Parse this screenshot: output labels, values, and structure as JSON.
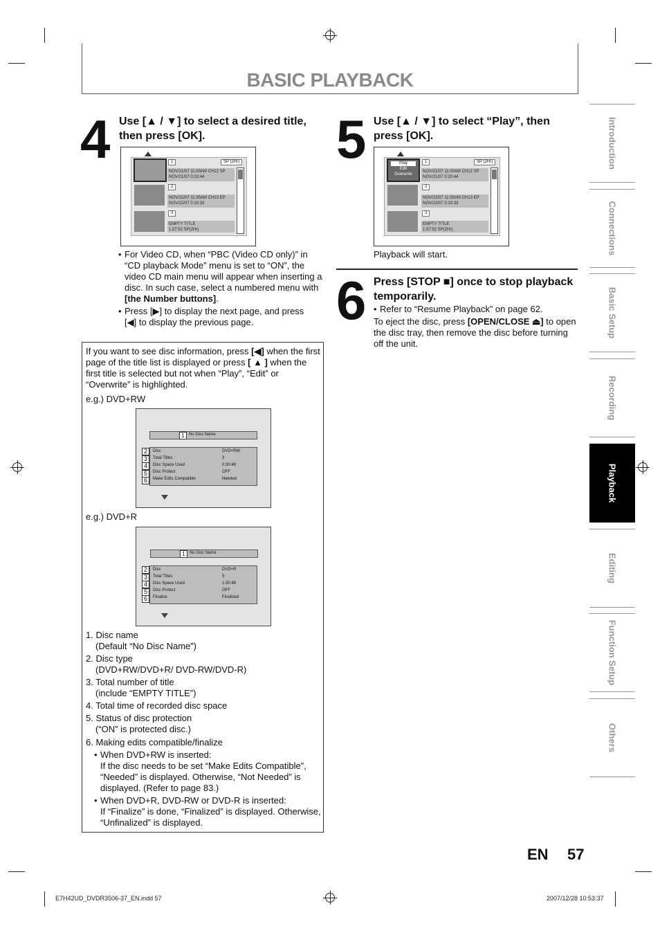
{
  "page_title": "BASIC PLAYBACK",
  "step4": {
    "number": "4",
    "title": "Use [▲ / ▼] to select a desired title, then press [OK].",
    "bullet1_pre": "For Video CD, when “PBC (Video CD only)” in “CD playback Mode” menu is set to “ON”, the video CD main menu will appear when inserting a disc. In such case, select a numbered menu with ",
    "bullet1_bold": "[the Number buttons]",
    "bullet1_post": ".",
    "bullet2_line1": "Press [▶] to display the next page, and press",
    "bullet2_line2": "[◀] to display the previous page."
  },
  "title_list": {
    "sp_tag": "SP (2Hr)",
    "items": [
      {
        "num": "1",
        "line1": "NOV/21/07  11:00AM CH12  SP",
        "line2": "NOV/21/07    0:20:44"
      },
      {
        "num": "2",
        "line1": "NOV/22/07  11:35AM CH13  EP",
        "line2": "NOV/22/07    0:10:33"
      },
      {
        "num": "3",
        "line1": "EMPTY TITLE",
        "line2": "1:37:52  SP(2Hr)"
      }
    ],
    "popup": [
      "Play",
      "Edit",
      "Overwrite"
    ]
  },
  "step5": {
    "number": "5",
    "title": "Use [▲ / ▼] to select “Play”, then press [OK].",
    "note": "Playback will start."
  },
  "step6": {
    "number": "6",
    "title": "Press [STOP ■] once to stop playback temporarily.",
    "bullet1": "Refer to “Resume Playback” on page 62.",
    "body_pre": "To eject the disc, press ",
    "body_bold": "[OPEN/CLOSE ⏏]",
    "body_post": " to open the disc tray, then remove the disc before turning off the unit."
  },
  "infobox": {
    "intro_pre": "If you want to see disc information, press ",
    "intro_bold1": "[◀]",
    "intro_mid": " when the first page of the title list is displayed or press ",
    "intro_bold2": "[ ▲ ]",
    "intro_post": " when the first title is selected but not when “Play”, “Edit” or “Overwrite” is highlighted.",
    "eg1": "e.g.) DVD+RW",
    "eg2": "e.g.) DVD+R",
    "disc_rw": {
      "name_num": "1",
      "name": "No Disc Name",
      "rows": [
        {
          "idx": "2",
          "k": "Disc",
          "v": "DVD+RW"
        },
        {
          "idx": "3",
          "k": "Total Titles",
          "v": "3"
        },
        {
          "idx": "4",
          "k": "Disc Space Used",
          "v": "0:30:48"
        },
        {
          "idx": "5",
          "k": "Disc Protect",
          "v": "OFF"
        },
        {
          "idx": "6",
          "k": "Make Edits Compatible",
          "v": "Needed"
        }
      ]
    },
    "disc_r": {
      "name_num": "1",
      "name": "No Disc Name",
      "rows": [
        {
          "idx": "2",
          "k": "Disc",
          "v": "DVD+R"
        },
        {
          "idx": "3",
          "k": "Total Titles",
          "v": "5"
        },
        {
          "idx": "4",
          "k": "Disc Space Used",
          "v": "1:30:48"
        },
        {
          "idx": "5",
          "k": "Disc Protect",
          "v": "OFF"
        },
        {
          "idx": "6",
          "k": "Finalize",
          "v": "Finalized"
        }
      ]
    },
    "list": [
      {
        "l1": "1. Disc name",
        "l2": "(Default “No Disc Name”)"
      },
      {
        "l1": "2. Disc type",
        "l2": "(DVD+RW/DVD+R/ DVD-RW/DVD-R)"
      },
      {
        "l1": "3. Total number of title",
        "l2": "(include “EMPTY TITLE”)"
      },
      {
        "l1": "4. Total time of recorded disc space",
        "l2": ""
      },
      {
        "l1": "5. Status of disc protection",
        "l2": "(“ON” is protected disc.)"
      },
      {
        "l1": "6. Making edits compatible/finalize",
        "l2": ""
      }
    ],
    "sub1_head": "When DVD+RW is inserted:",
    "sub1_body": "If the disc needs to be set “Make Edits Compatible”, “Needed” is displayed. Otherwise, “Not Needed” is displayed. (Refer to page 83.)",
    "sub2_head": "When DVD+R, DVD-RW or DVD-R is inserted:",
    "sub2_body": "If “Finalize” is done, “Finalized”  is displayed. Otherwise, “Unfinalized” is displayed."
  },
  "side_tabs": [
    "Introduction",
    "Connections",
    "Basic Setup",
    "Recording",
    "Playback",
    "Editing",
    "Function Setup",
    "Others"
  ],
  "active_tab": "Playback",
  "lang": "EN",
  "page_number": "57",
  "footer_left": "E7H42UD_DVDR3506-37_EN.indd   57",
  "footer_right": "2007/12/28   10:53:37"
}
